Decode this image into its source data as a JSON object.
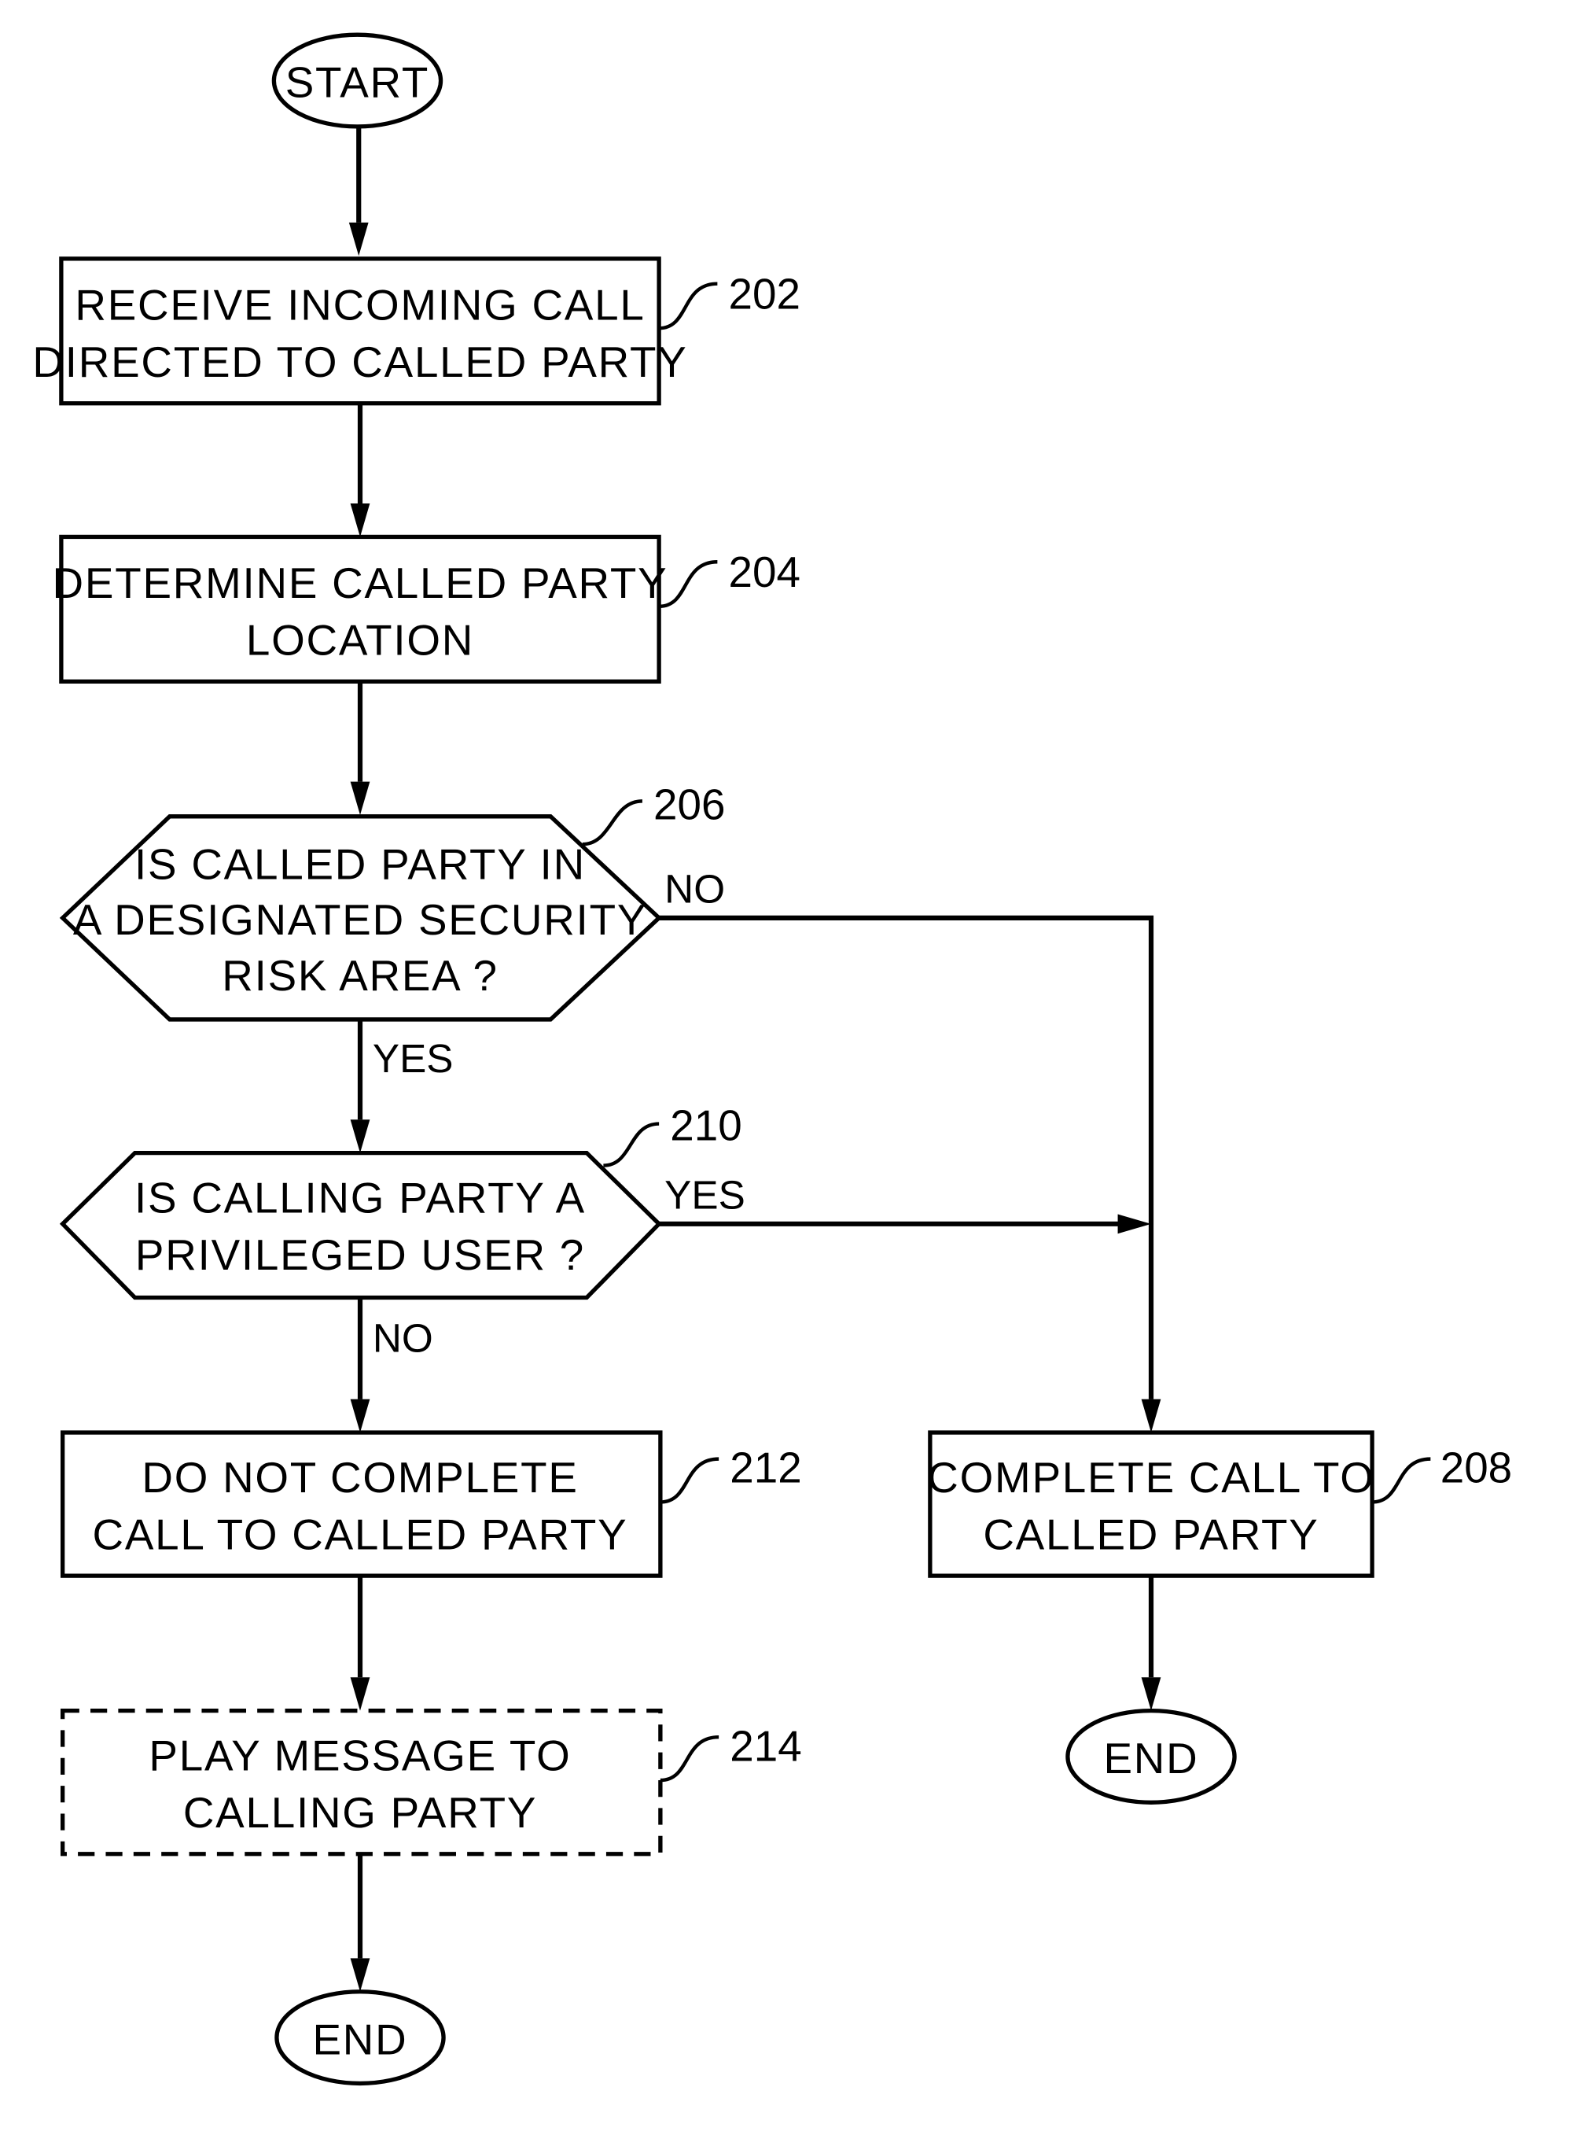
{
  "diagram": {
    "type": "flowchart",
    "nodes": {
      "start": {
        "label": "START"
      },
      "n202": {
        "ref": "202",
        "lines": [
          "RECEIVE INCOMING CALL",
          "DIRECTED TO CALLED PARTY"
        ]
      },
      "n204": {
        "ref": "204",
        "lines": [
          "DETERMINE CALLED PARTY",
          "LOCATION"
        ]
      },
      "n206": {
        "ref": "206",
        "lines": [
          "IS CALLED PARTY IN",
          "A DESIGNATED SECURITY",
          "RISK AREA ?"
        ]
      },
      "n210": {
        "ref": "210",
        "lines": [
          "IS CALLING PARTY A",
          "PRIVILEGED USER ?"
        ]
      },
      "n212": {
        "ref": "212",
        "lines": [
          "DO NOT COMPLETE",
          "CALL TO CALLED PARTY"
        ]
      },
      "n208": {
        "ref": "208",
        "lines": [
          "COMPLETE CALL TO",
          "CALLED PARTY"
        ]
      },
      "n214": {
        "ref": "214",
        "lines": [
          "PLAY MESSAGE TO",
          "CALLING PARTY"
        ],
        "optional": true
      },
      "end_left": {
        "label": "END"
      },
      "end_right": {
        "label": "END"
      }
    },
    "edge_labels": {
      "n206_no": "NO",
      "n206_yes": "YES",
      "n210_yes": "YES",
      "n210_no": "NO"
    },
    "edges": [
      {
        "from": "start",
        "to": "n202"
      },
      {
        "from": "n202",
        "to": "n204"
      },
      {
        "from": "n204",
        "to": "n206"
      },
      {
        "from": "n206",
        "to": "n210",
        "label": "YES"
      },
      {
        "from": "n206",
        "to": "n208",
        "label": "NO"
      },
      {
        "from": "n210",
        "to": "n208",
        "label": "YES"
      },
      {
        "from": "n210",
        "to": "n212",
        "label": "NO"
      },
      {
        "from": "n212",
        "to": "n214"
      },
      {
        "from": "n214",
        "to": "end_left"
      },
      {
        "from": "n208",
        "to": "end_right"
      }
    ]
  }
}
